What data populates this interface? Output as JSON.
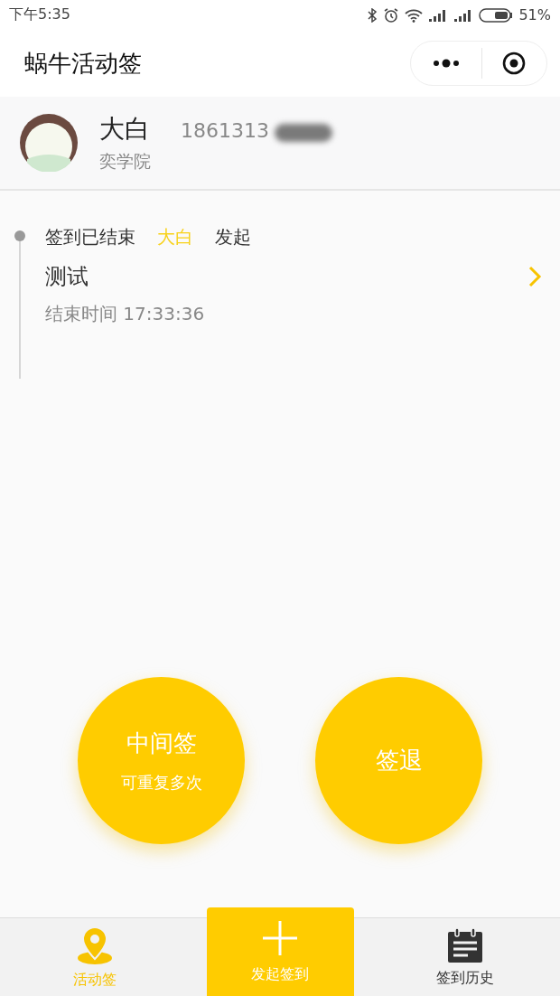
{
  "status_bar": {
    "time": "下午5:35",
    "battery": "51%"
  },
  "header": {
    "title": "蜗牛活动签"
  },
  "profile": {
    "name": "大白",
    "phone": "1861313",
    "org": "奕学院"
  },
  "events": [
    {
      "status": "签到已结束",
      "initiator": "大白",
      "action": "发起",
      "title": "测试",
      "end_time": "结束时间 17:33:36"
    }
  ],
  "actions": [
    {
      "label": "中间签",
      "sub": "可重复多次"
    },
    {
      "label": "签退"
    }
  ],
  "tab_bar": [
    {
      "kind": "tab",
      "label": "活动签",
      "selected": true
    },
    {
      "kind": "action",
      "label": "发起签到"
    },
    {
      "kind": "tab",
      "label": "签到历史",
      "selected": false
    }
  ]
}
